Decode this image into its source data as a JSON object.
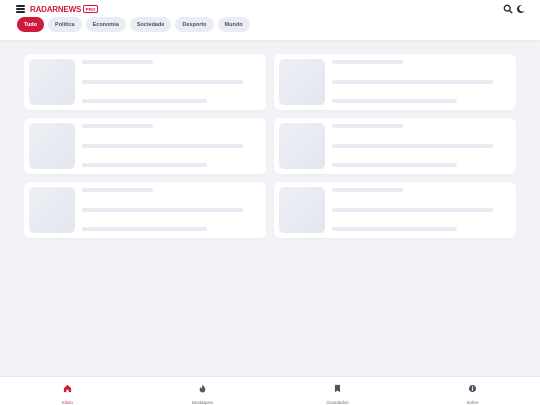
{
  "header": {
    "brand": "RADARNEWS",
    "badge": "PRO",
    "icons": {
      "menu": "hamburger-menu-icon",
      "search": "search-icon",
      "theme": "moon-icon"
    }
  },
  "categories": [
    {
      "label": "Tudo",
      "active": true
    },
    {
      "label": "Política",
      "active": false
    },
    {
      "label": "Economia",
      "active": false
    },
    {
      "label": "Sociedade",
      "active": false
    },
    {
      "label": "Desporto",
      "active": false
    },
    {
      "label": "Mundo",
      "active": false
    }
  ],
  "feed": {
    "state": "loading",
    "placeholder_cards": 6
  },
  "bottom_nav": [
    {
      "label": "Início",
      "icon": "home-icon",
      "active": true
    },
    {
      "label": "Destaques",
      "icon": "flame-icon",
      "active": false
    },
    {
      "label": "Guardados",
      "icon": "bookmark-icon",
      "active": false
    },
    {
      "label": "Sobre",
      "icon": "info-icon",
      "active": false
    }
  ],
  "colors": {
    "accent": "#d11a3b",
    "background": "#f1f3f7",
    "surface": "#ffffff",
    "skeleton": "#e8ebf1",
    "text_muted": "#6b7280"
  }
}
